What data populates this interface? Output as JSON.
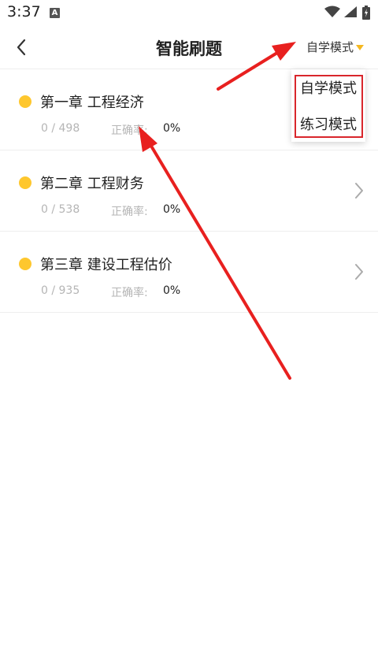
{
  "status_bar": {
    "time": "3:37",
    "notification_icon": "a-icon",
    "icons": [
      "wifi-icon",
      "signal-icon",
      "battery-icon"
    ]
  },
  "header": {
    "back_icon": "chevron-left-icon",
    "title": "智能刷题",
    "mode_selector": {
      "label": "自学模式",
      "caret_icon": "caret-down-icon",
      "caret_color": "#f5b820"
    }
  },
  "chapters": [
    {
      "title": "第一章 工程经济",
      "progress": "0 / 498",
      "accuracy_label": "正确率:",
      "accuracy_value": "0%",
      "show_chevron": false
    },
    {
      "title": "第二章 工程财务",
      "progress": "0 / 538",
      "accuracy_label": "正确率:",
      "accuracy_value": "0%",
      "show_chevron": true
    },
    {
      "title": "第三章 建设工程估价",
      "progress": "0 / 935",
      "accuracy_label": "正确率:",
      "accuracy_value": "0%",
      "show_chevron": true
    }
  ],
  "mode_dropdown": {
    "options": [
      "自学模式",
      "练习模式"
    ],
    "highlight_color": "#d9262c"
  },
  "colors": {
    "accent_dot": "#fec72e",
    "annotation_arrow": "#e8201f",
    "muted_text": "#b5b5b5"
  }
}
